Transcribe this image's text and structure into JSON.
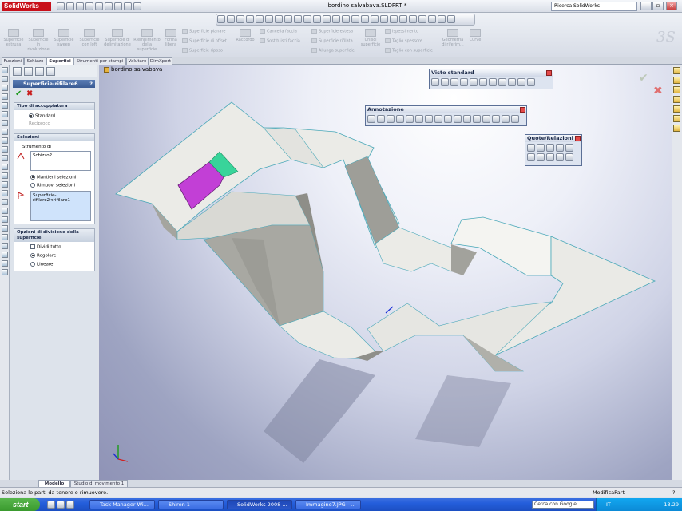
{
  "app": {
    "logo": "SolidWorks",
    "document_title": "bordino salvabava.SLDPRT *"
  },
  "search": {
    "placeholder": "Ricerca SolidWorks"
  },
  "ribbon": {
    "big_buttons": [
      "Superficie estrusa",
      "Superficie in rivoluzione",
      "Superficie sweep",
      "Superficie con loft",
      "Superficie di delimitazione",
      "Riempimento della superficie",
      "Forma libera"
    ],
    "small_col1": [
      "Superficie planare",
      "Superficie di offset",
      "Superficie riposo"
    ],
    "raccordo": "Raccordo",
    "small_col2": [
      "Cancella faccia",
      "Sostituisci faccia"
    ],
    "small_col3": [
      "Superficie estesa",
      "Superficie rifilata",
      "Allunga superficie"
    ],
    "unisci": "Unisci superficie",
    "small_col4": [
      "Ispessimento",
      "Taglio spessore",
      "Taglio con superficie"
    ],
    "geometria": "Geometria di riferim...",
    "curve": "Curve"
  },
  "tabs": [
    "Funzioni",
    "Schizzo",
    "Superfici",
    "Strumenti per stampi",
    "Valutare",
    "DimXpert"
  ],
  "active_tab": "Superfici",
  "property_manager": {
    "title": "Superficie-rifilare6",
    "help": "?",
    "ok": "✔",
    "cancel": "✖",
    "trim_type": {
      "header": "Tipo di accoppiatura",
      "options": [
        "Standard",
        "Reciproco"
      ]
    },
    "selections": {
      "header": "Selezioni",
      "tool_label": "Strumento di",
      "tool_value": "Schizzo2",
      "options": [
        "Mantieni selezioni",
        "Rimuovi selezioni"
      ],
      "surfaces_value": "Superficie-rifilare2<rifilare1"
    },
    "split": {
      "header": "Opzioni di divisione della superficie",
      "options": [
        "Dividi tutto",
        "Regolare",
        "Lineare"
      ]
    }
  },
  "tree_item": "bordino salvabava",
  "toolbars": {
    "viste": "Viste standard",
    "annotazione": "Annotazione",
    "quote": "Quote/Relazioni"
  },
  "bottom_tabs": [
    "Modello",
    "Studio di movimento 1"
  ],
  "status": {
    "message": "Seleziona le parti da tenere o rimuovere.",
    "mode": "ModificaPart",
    "help": "?"
  },
  "taskbar": {
    "start": "start",
    "items": [
      "Task Manager Wi...",
      "Shiren 1",
      "SolidWorks 2008 ...",
      "Immagine7.JPG - ..."
    ],
    "search_placeholder": "Cerca con Google",
    "lang": "IT",
    "clock": "13.29"
  },
  "colors": {
    "selected_face": "#c23fd6",
    "accent_face": "#38d49a",
    "surface": "#e9e9e5"
  }
}
